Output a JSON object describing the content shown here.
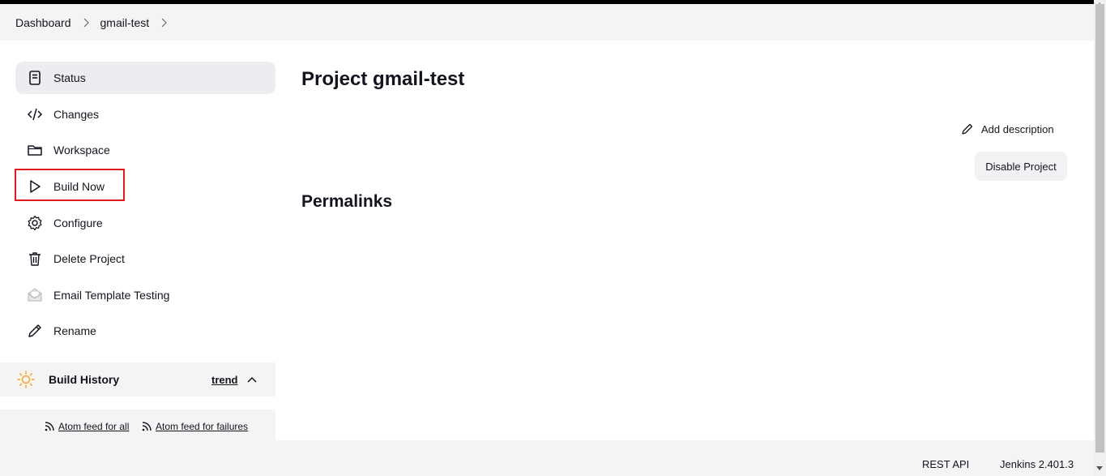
{
  "breadcrumb": {
    "items": [
      "Dashboard",
      "gmail-test"
    ]
  },
  "sidebar": {
    "tasks": [
      {
        "label": "Status",
        "icon": "document-icon"
      },
      {
        "label": "Changes",
        "icon": "code-icon"
      },
      {
        "label": "Workspace",
        "icon": "folder-icon"
      },
      {
        "label": "Build Now",
        "icon": "play-icon"
      },
      {
        "label": "Configure",
        "icon": "gear-icon"
      },
      {
        "label": "Delete Project",
        "icon": "trash-icon"
      },
      {
        "label": "Email Template Testing",
        "icon": "envelope-icon"
      },
      {
        "label": "Rename",
        "icon": "pencil-icon"
      }
    ],
    "build_history": {
      "title": "Build History",
      "trend": "trend"
    },
    "feeds": {
      "all": "Atom feed for all",
      "failures": "Atom feed for failures"
    }
  },
  "main": {
    "title": "Project gmail-test",
    "add_description": "Add description",
    "disable_button": "Disable Project",
    "permalinks": "Permalinks"
  },
  "footer": {
    "rest_api": "REST API",
    "version": "Jenkins 2.401.3"
  },
  "colors": {
    "highlight": "#e01a1a",
    "sun": "#f5a623",
    "active_bg": "#ececf1"
  }
}
